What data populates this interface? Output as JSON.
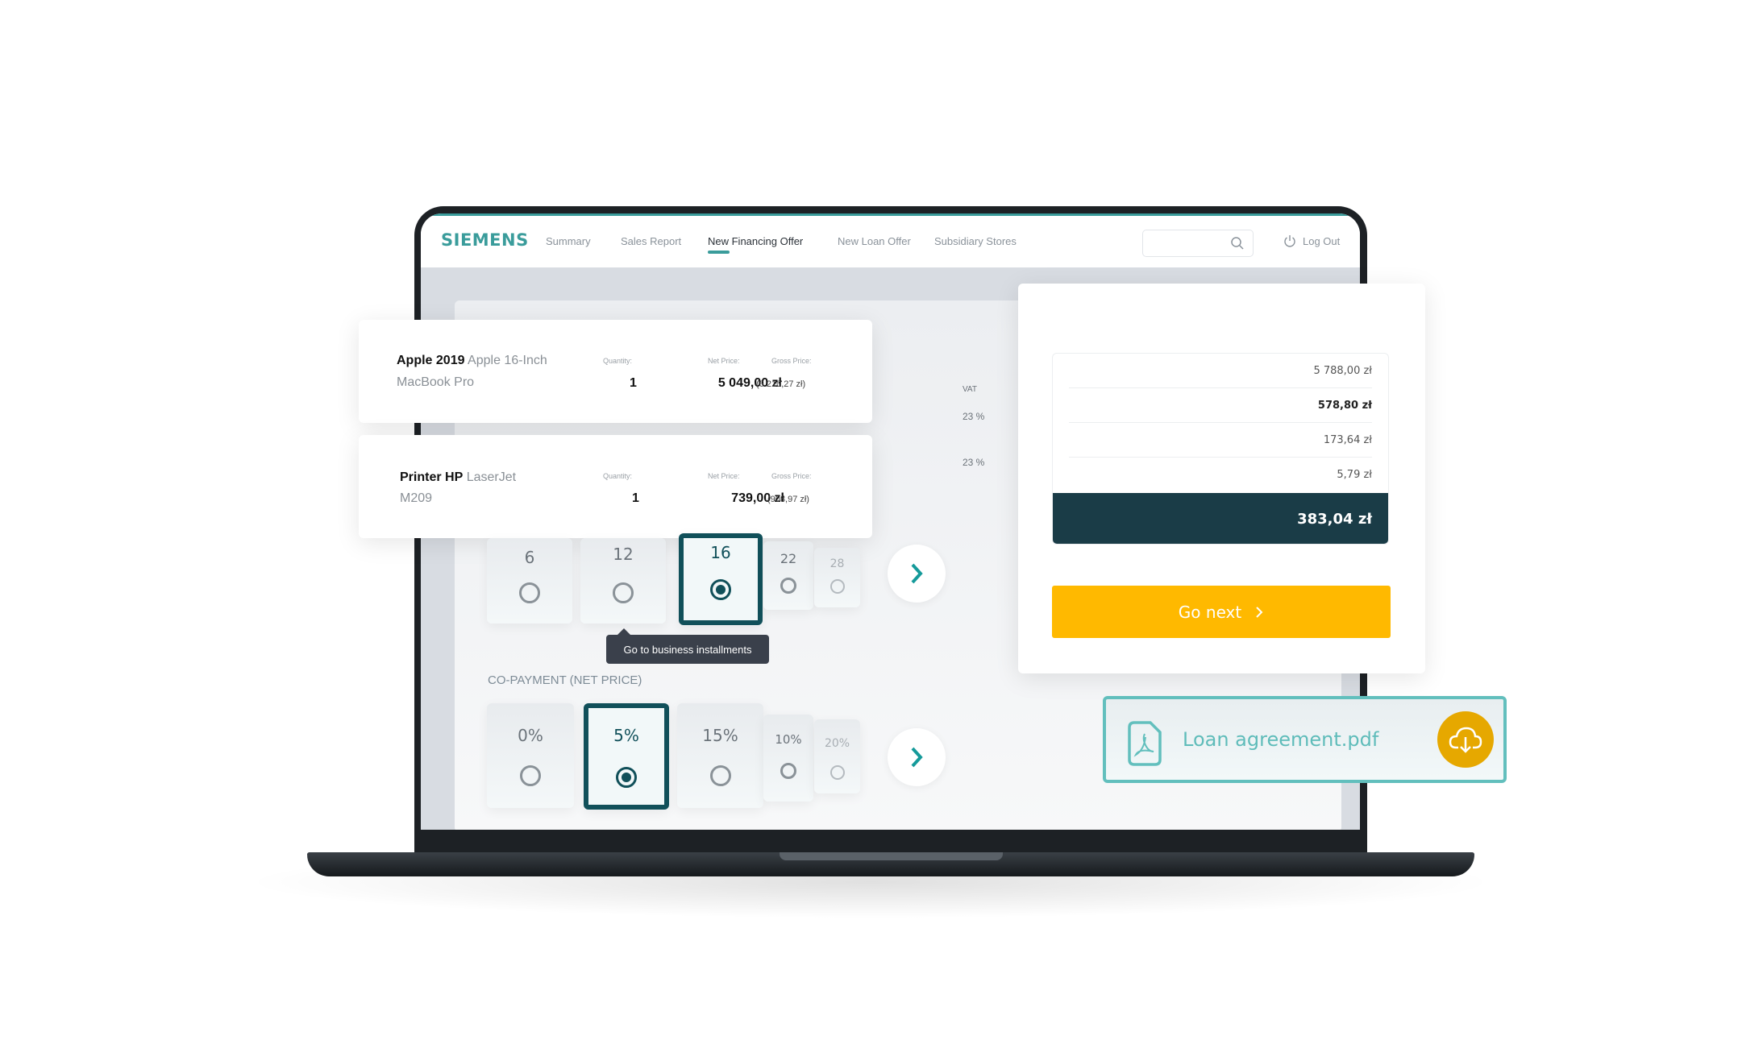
{
  "colors": {
    "brand": "#3a9c9b",
    "selected": "#11505a",
    "summary_total_bg": "#1a3c47",
    "go_next": "#ffb900",
    "pdf_accent": "#62bfbd",
    "download": "#e6a800"
  },
  "nav": {
    "logo": "SIEMENS",
    "items": [
      {
        "label": "Summary"
      },
      {
        "label": "Sales Report"
      },
      {
        "label": "New Financing Offer",
        "active": true
      },
      {
        "label": "New Loan Offer"
      },
      {
        "label": "Subsidiary Stores"
      }
    ],
    "search_placeholder": "",
    "search_icon": "search-icon",
    "logout": "Log Out",
    "logout_icon": "power-icon"
  },
  "products": [
    {
      "brand": "Apple 2019",
      "name": "Apple 16-Inch",
      "name2": "MacBook Pro",
      "qty_label": "Quantity:",
      "qty": "1",
      "net_label": "Net Price:",
      "net": "5 049,00 zł",
      "gross_label": "Gross Price:",
      "gross": "(6 210,27 zł)"
    },
    {
      "brand": "Printer HP",
      "name": "LaserJet",
      "name2": "M209",
      "qty_label": "Quantity:",
      "qty": "1",
      "net_label": "Net Price:",
      "net": "739,00 zł",
      "gross_label": "Gross Price:",
      "gross": "(908,97 zł)"
    }
  ],
  "vat": {
    "header": "VAT",
    "values": [
      "23 %",
      "23 %"
    ]
  },
  "installments": {
    "options": [
      "6",
      "12",
      "16",
      "22",
      "28"
    ],
    "selected": "16",
    "tooltip": "Go to business installments"
  },
  "copayment": {
    "label": "CO-PAYMENT (NET PRICE)",
    "options": [
      "0%",
      "5%",
      "15%",
      "10%",
      "20%"
    ],
    "selected": "5%"
  },
  "summary": {
    "rows": [
      {
        "value": "5 788,00 zł"
      },
      {
        "value": "578,80 zł",
        "bold": true
      },
      {
        "value": "173,64 zł"
      },
      {
        "value": "5,79 zł"
      }
    ],
    "total": "383,04 zł"
  },
  "go_next": "Go next",
  "pdf": {
    "filename": "Loan agreement.pdf",
    "icon": "pdf-file-icon",
    "action_icon": "cloud-download-icon"
  }
}
